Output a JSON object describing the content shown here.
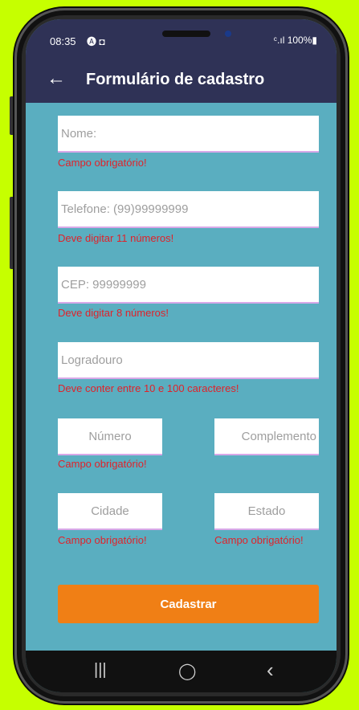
{
  "status": {
    "time": "08:35",
    "icons_left": "🅐 ◘",
    "right": "ᶜ.ıl 100%▮"
  },
  "appbar": {
    "back_icon": "←",
    "title": "Formulário de cadastro"
  },
  "form": {
    "nome": {
      "placeholder": "Nome:",
      "error": "Campo obrigatório!"
    },
    "telefone": {
      "placeholder": "Telefone: (99)99999999",
      "error": "Deve digitar 11 números!"
    },
    "cep": {
      "placeholder": "CEP: 99999999",
      "error": "Deve digitar 8 números!"
    },
    "logradouro": {
      "placeholder": "Logradouro",
      "error": "Deve conter entre 10 e 100 caracteres!"
    },
    "numero": {
      "placeholder": "Número",
      "error": "Campo obrigatório!"
    },
    "complemento": {
      "placeholder": "Complemento"
    },
    "cidade": {
      "placeholder": "Cidade",
      "error": "Campo obrigatório!"
    },
    "estado": {
      "placeholder": "Estado",
      "error": "Campo obrigatório!"
    },
    "submit_label": "Cadastrar"
  },
  "navbar": {
    "recent": "|||",
    "home": "◯",
    "back": "‹"
  },
  "colors": {
    "accent": "#f07f15",
    "background": "#5aaec0",
    "appbar": "#2f3256",
    "error": "#e0222a"
  }
}
